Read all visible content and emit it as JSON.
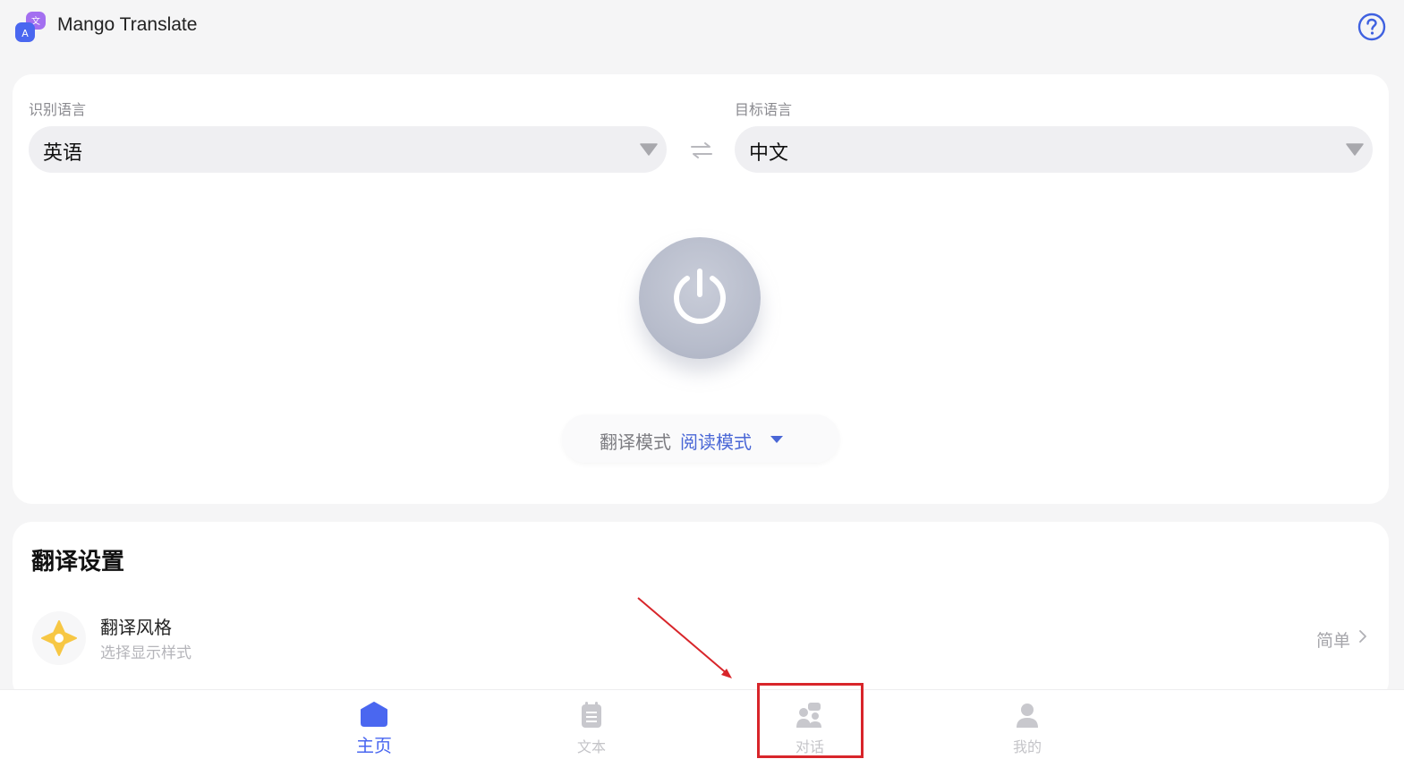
{
  "header": {
    "app_title": "Mango Translate"
  },
  "language": {
    "source_label": "识别语言",
    "source_value": "英语",
    "target_label": "目标语言",
    "target_value": "中文"
  },
  "mode": {
    "label": "翻译模式",
    "value": "阅读模式"
  },
  "settings": {
    "title": "翻译设置",
    "style_name": "翻译风格",
    "style_desc": "选择显示样式",
    "style_value": "简单"
  },
  "nav": {
    "items": [
      {
        "label": "主页",
        "icon": "home-icon",
        "active": true
      },
      {
        "label": "文本",
        "icon": "document-icon",
        "active": false
      },
      {
        "label": "对话",
        "icon": "conversation-icon",
        "active": false
      },
      {
        "label": "我的",
        "icon": "profile-icon",
        "active": false
      }
    ]
  },
  "colors": {
    "accent": "#4a67f0",
    "highlight": "#d8252a",
    "style_icon": "#f7c744"
  }
}
